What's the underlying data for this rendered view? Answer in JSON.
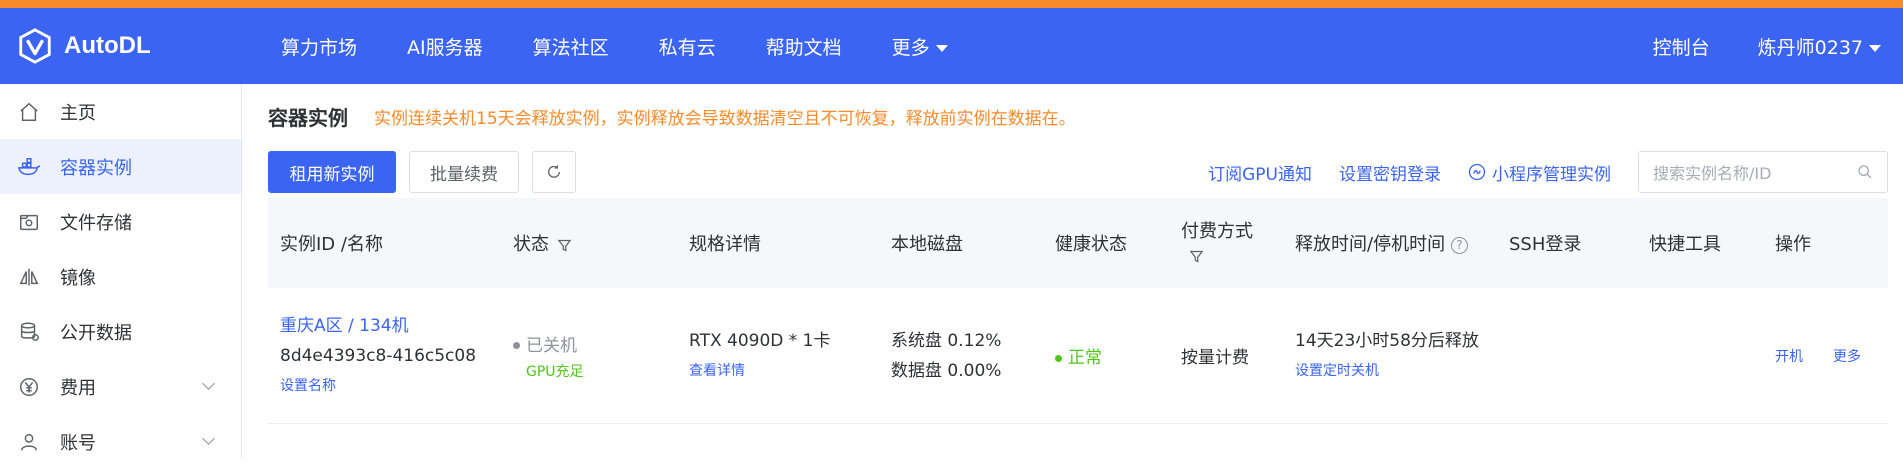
{
  "brand": {
    "name": "AutoDL"
  },
  "nav": {
    "items": [
      "算力市场",
      "AI服务器",
      "算法社区",
      "私有云",
      "帮助文档",
      "更多"
    ],
    "console": "控制台",
    "user": "炼丹师0237"
  },
  "sidebar": {
    "items": [
      {
        "label": "主页",
        "icon": "home-icon"
      },
      {
        "label": "容器实例",
        "icon": "container-icon"
      },
      {
        "label": "文件存储",
        "icon": "folder-icon"
      },
      {
        "label": "镜像",
        "icon": "image-icon"
      },
      {
        "label": "公开数据",
        "icon": "database-icon"
      },
      {
        "label": "费用",
        "icon": "yen-icon"
      },
      {
        "label": "账号",
        "icon": "user-icon"
      }
    ]
  },
  "page": {
    "title": "容器实例",
    "warning": "实例连续关机15天会释放实例，实例释放会导致数据清空且不可恢复，释放前实例在数据在。"
  },
  "toolbar": {
    "rent_label": "租用新实例",
    "renew_label": "批量续费",
    "subscribe_label": "订阅GPU通知",
    "key_login_label": "设置密钥登录",
    "miniprogram_label": "小程序管理实例",
    "search_placeholder": "搜索实例名称/ID"
  },
  "table": {
    "headers": [
      "实例ID /名称",
      "状态",
      "规格详情",
      "本地磁盘",
      "健康状态",
      "付费方式",
      "释放时间/停机时间",
      "SSH登录",
      "快捷工具",
      "操作"
    ],
    "row": {
      "region": "重庆A区 / 134机",
      "id": "8d4e4393c8-416c5c08",
      "set_name": "设置名称",
      "status": "已关机",
      "gpu_status": "GPU充足",
      "spec": "RTX 4090D * 1卡",
      "spec_detail": "查看详情",
      "disk_sys": "系统盘 0.12%",
      "disk_data": "数据盘 0.00%",
      "health": "正常",
      "billing": "按量计费",
      "release": "14天23小时58分后释放",
      "set_shutdown": "设置定时关机",
      "start": "开机",
      "more": "更多"
    }
  },
  "colors": {
    "primary": "#3b64f3",
    "warning": "#f78b2b",
    "success": "#52c41a"
  }
}
